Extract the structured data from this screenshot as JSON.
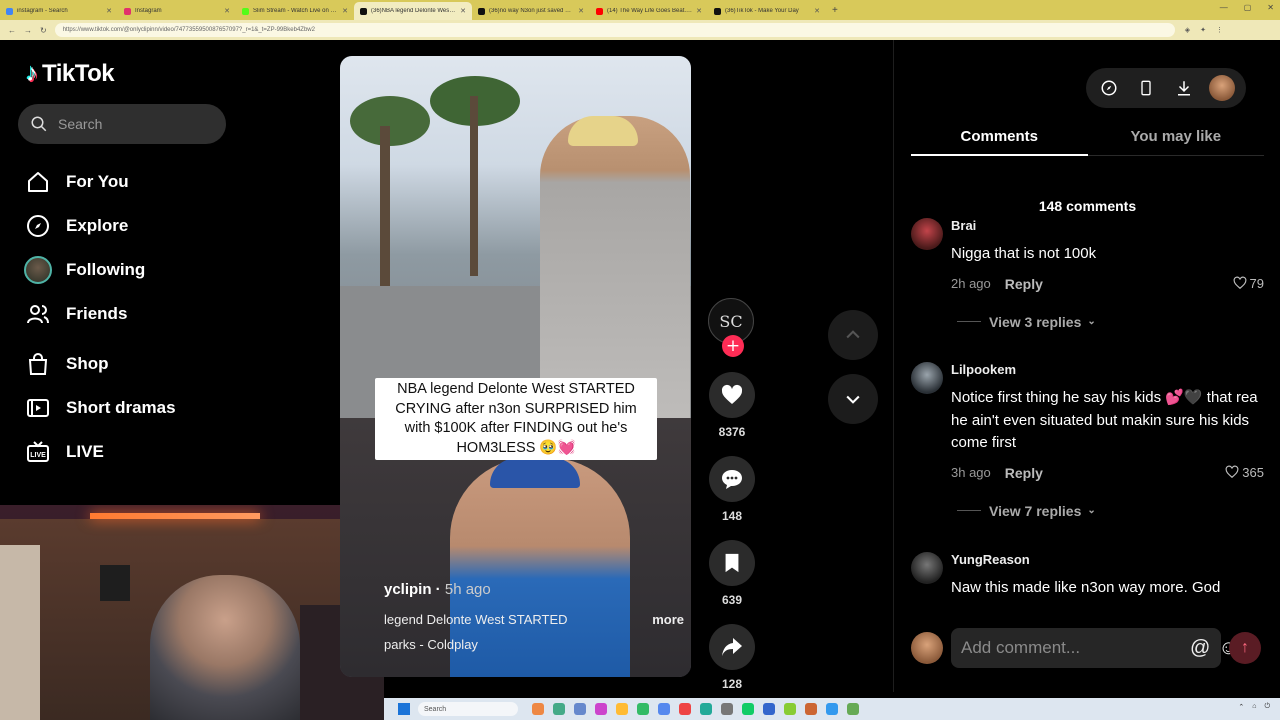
{
  "browser": {
    "tabs": [
      {
        "label": "instagram - Search",
        "color": "#4285f4",
        "active": false
      },
      {
        "label": "Instagram",
        "color": "#e1306c",
        "active": false
      },
      {
        "label": "Slim Stream - Watch Live on Kick",
        "color": "#53fc18",
        "active": false
      },
      {
        "label": "(36)NBA legend Delonte West STA",
        "color": "#111111",
        "active": true
      },
      {
        "label": "(36)no way N3on just saved Delon",
        "color": "#111111",
        "active": false
      },
      {
        "label": "(14) The Way Life Goes Beat. Oh",
        "color": "#ff0000",
        "active": false
      },
      {
        "label": "(36)TikTok - Make Your Day",
        "color": "#111111",
        "active": false
      }
    ],
    "new_tab": "+",
    "url": "https://www.tiktok.com/@onlyclipinn/video/7477355950087657097?_r=1&_t=ZP-99Bkeb4Zbw2"
  },
  "sidebar": {
    "logo_text": "TikTok",
    "search_placeholder": "Search",
    "items": [
      {
        "label": "For You",
        "icon": "home-icon"
      },
      {
        "label": "Explore",
        "icon": "compass-icon"
      },
      {
        "label": "Following",
        "icon": "following-avatar"
      },
      {
        "label": "Friends",
        "icon": "friends-icon"
      },
      {
        "label": "Shop",
        "icon": "shop-icon"
      },
      {
        "label": "Short dramas",
        "icon": "drama-icon"
      },
      {
        "label": "LIVE",
        "icon": "live-icon"
      }
    ]
  },
  "video": {
    "caption": "NBA legend Delonte West STARTED CRYING after n3on SURPRISED him with $100K after FINDING out he's HOM3LESS 🥹💓",
    "author": "yclipin",
    "time_ago": "5h ago",
    "description": "legend Delonte West STARTED",
    "more_label": "more",
    "music": "parks - Coldplay",
    "creator_avatar_text": "SC"
  },
  "actions": {
    "likes": "8376",
    "comments": "148",
    "saves": "639",
    "shares": "128"
  },
  "panel": {
    "tabs": [
      "Comments",
      "You may like"
    ],
    "comment_count": "148 comments",
    "comments": [
      {
        "user": "Brai",
        "text": "Nigga that is not 100k",
        "time": "2h ago",
        "reply": "Reply",
        "likes": "79",
        "view_replies": "View 3 replies",
        "avatar_color": "#7a2a2a"
      },
      {
        "user": "Lilpookem",
        "text": "Notice first thing he say his kids 💕🖤 that rea he ain't even situated but makin sure his kids come first",
        "time": "3h ago",
        "reply": "Reply",
        "likes": "365",
        "view_replies": "View 7 replies",
        "avatar_color": "#55606a"
      },
      {
        "user": "YungReason",
        "text": "Naw this made like n3on way more. God",
        "time": "",
        "reply": "",
        "likes": "",
        "view_replies": "",
        "avatar_color": "#3a3a3a"
      }
    ],
    "add_comment_placeholder": "Add comment...",
    "mention_label": "@",
    "emoji_label": "☺"
  },
  "taskbar": {
    "search_label": "Search"
  }
}
